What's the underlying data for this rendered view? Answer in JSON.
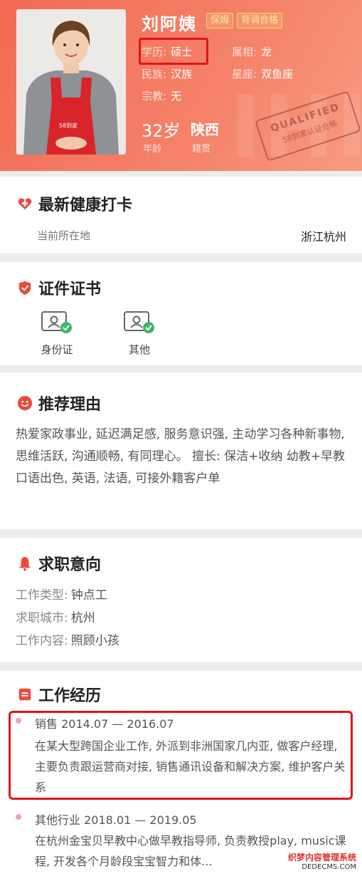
{
  "profile": {
    "name": "刘阿姨",
    "tags": [
      "保姆",
      "背调合格"
    ],
    "education_label": "学历:",
    "education": "硕士",
    "zodiac_label": "属相:",
    "zodiac": "龙",
    "ethnicity_label": "民族:",
    "ethnicity": "汉族",
    "constellation_label": "星座:",
    "constellation": "双鱼座",
    "religion_label": "宗教:",
    "religion": "无",
    "age": "32岁",
    "age_label": "年龄",
    "native_place": "陕西",
    "native_place_label": "籍贯",
    "stamp_line1": "QUALIFIED",
    "stamp_line2": "58到家认证合格",
    "apron_logo": "58到家"
  },
  "health": {
    "title": "最新健康打卡",
    "location_label": "当前所在地",
    "location": "浙江杭州"
  },
  "certificates": {
    "title": "证件证书",
    "items": [
      "身份证",
      "其他"
    ]
  },
  "recommend": {
    "title": "推荐理由",
    "text": "热爱家政事业, 延迟满足感, 服务意识强, 主动学习各种新事物, 思维活跃, 沟通顺畅, 有同理心。 擅长: 保洁+收纳 幼教+早教 口语出色, 英语, 法语, 可接外籍客户单"
  },
  "job_intent": {
    "title": "求职意向",
    "type_label": "工作类型:",
    "type": "钟点工",
    "city_label": "求职城市:",
    "city": "杭州",
    "content_label": "工作内容:",
    "content": "照顾小孩"
  },
  "experience": {
    "title": "工作经历",
    "items": [
      {
        "header": "销售 2014.07 — 2016.07",
        "desc": "在某大型跨国企业工作, 外派到非洲国家几内亚, 做客户经理, 主要负责跟运营商对接, 销售通讯设备和解决方案, 维护客户关系"
      },
      {
        "header": "其他行业 2018.01 — 2019.05",
        "desc": "在杭州金宝贝早教中心做早教指导师, 负责教授play, music课程, 开发各个月龄段宝宝智力和体..."
      }
    ]
  },
  "watermark": {
    "line1": "织梦内容管理系统",
    "line2": "DEDECMS.COM"
  },
  "colors": {
    "header_bg": "#f26a55",
    "accent_red": "#e0141a",
    "icon_red": "#ea4c3c"
  }
}
